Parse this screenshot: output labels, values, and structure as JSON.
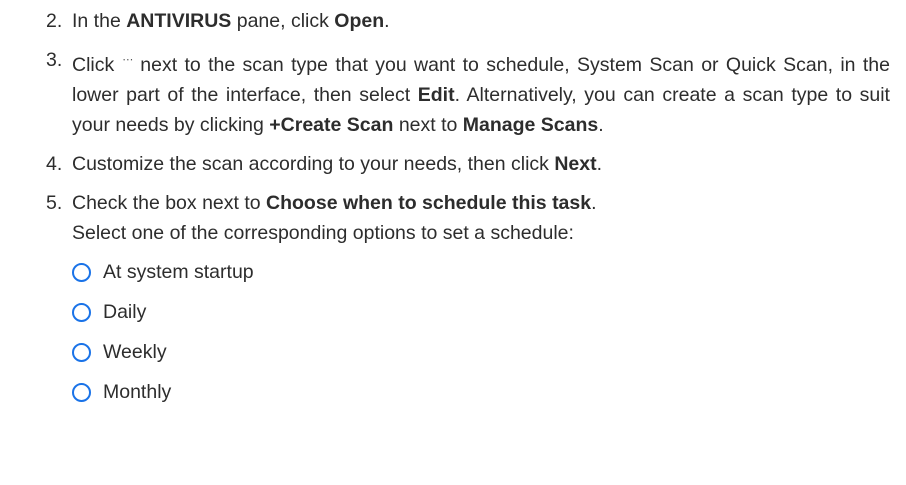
{
  "steps": [
    {
      "number": "2.",
      "t1": "In the ",
      "b1": "ANTIVIRUS",
      "t2": " pane, click ",
      "b2": "Open",
      "t3": "."
    },
    {
      "number": "3.",
      "t1": "Click",
      "more_icon": "more-horizontal-icon",
      "t2": "next to the scan type that you want to schedule, System Scan or Quick Scan, in the lower part of the interface, then select ",
      "b1": "Edit",
      "t3": ". Alternatively, you can create a scan type to suit your needs by clicking ",
      "b2": "+Create Scan",
      "t4": " next to ",
      "b3": "Manage Scans",
      "t5": "."
    },
    {
      "number": "4.",
      "t1": "Customize the scan according to your needs, then click ",
      "b1": "Next",
      "t2": "."
    },
    {
      "number": "5.",
      "t1": "Check the box next to ",
      "b1": "Choose when to schedule this task",
      "t2": ".",
      "t3": "Select one of the corresponding options to set a schedule:"
    }
  ],
  "schedule_options": [
    "At system startup",
    "Daily",
    "Weekly",
    "Monthly"
  ],
  "colors": {
    "text": "#2d2d2d",
    "radio_border": "#1a73e8"
  }
}
